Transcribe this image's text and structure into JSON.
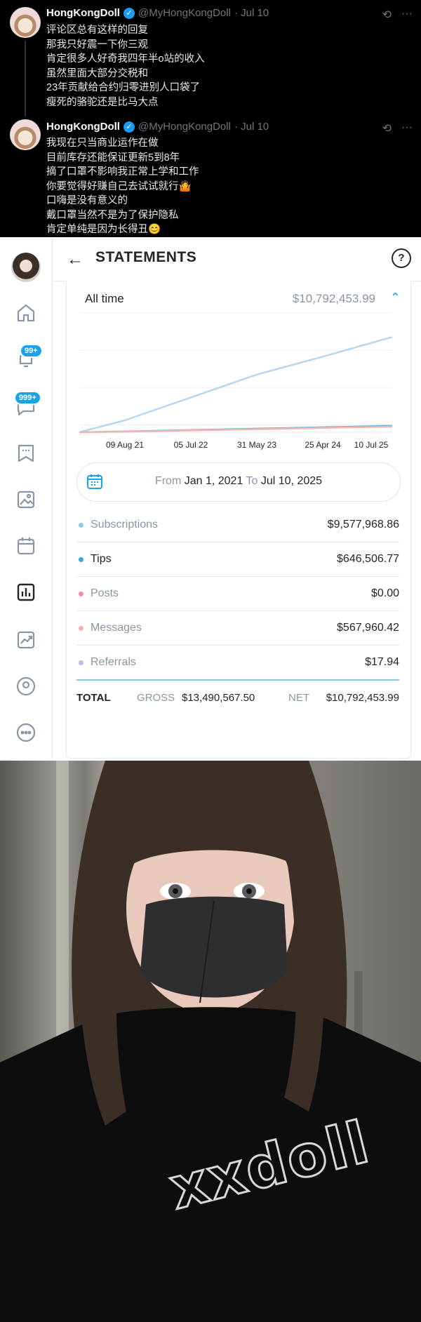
{
  "tweets": [
    {
      "name": "HongKongDoll",
      "handle": "@MyHongKongDoll",
      "date": "· Jul 10",
      "lines": [
        "评论区总有这样的回复",
        "那我只好震一下你三观",
        "肯定很多人好奇我四年半o站的收入",
        "虽然里面大部分交税和",
        "23年贡献给合约归零进别人口袋了",
        "瘦死的骆驼还是比马大点"
      ]
    },
    {
      "name": "HongKongDoll",
      "handle": "@MyHongKongDoll",
      "date": "· Jul 10",
      "lines": [
        "我现在只当商业运作在做",
        "目前库存还能保证更新5到8年",
        "摘了口罩不影响我正常上学和工作",
        "你要觉得好赚自己去试试就行🤷",
        "口嗨是没有意义的",
        "戴口罩当然不是为了保护隐私",
        "肯定单纯是因为长得丑😊"
      ]
    }
  ],
  "sidebar": {
    "notifications_badge": "99+",
    "messages_badge": "999+",
    "icons": [
      "home-icon",
      "bell-icon",
      "chat-icon",
      "bookmark-icon",
      "image-icon",
      "calendar-icon",
      "statistics-icon",
      "trend-icon",
      "profile-icon",
      "more-icon"
    ]
  },
  "header": {
    "title": "STATEMENTS"
  },
  "summary": {
    "period_label": "All time",
    "period_value": "$10,792,453.99"
  },
  "chart_data": {
    "type": "line",
    "x": [
      "09 Aug 21",
      "05 Jul 22",
      "31 May 23",
      "25 Apr 24",
      "10 Jul 25"
    ],
    "series": [
      {
        "values": [
          1200000,
          3500000,
          5800000,
          7600000,
          9577968
        ]
      },
      {
        "values": [
          80000,
          220000,
          360000,
          500000,
          646506
        ]
      },
      {
        "values": [
          60000,
          180000,
          310000,
          440000,
          567960
        ]
      }
    ],
    "colors": [
      "#b6d7f2",
      "#5fb3d9",
      "#f2b5b0"
    ],
    "grid": true
  },
  "date_range": {
    "from_label": "From",
    "from": "Jan 1, 2021",
    "to_label": "To",
    "to": "Jul 10, 2025"
  },
  "breakdown": [
    {
      "label": "Subscriptions",
      "amount": "$9,577,968.86",
      "color": "#8dc7ec"
    },
    {
      "label": "Tips",
      "amount": "$646,506.77",
      "color": "#3aa6d8"
    },
    {
      "label": "Posts",
      "amount": "$0.00",
      "color": "#f08ca6"
    },
    {
      "label": "Messages",
      "amount": "$567,960.42",
      "color": "#f5b1a8"
    },
    {
      "label": "Referrals",
      "amount": "$17.94",
      "color": "#c9b6e4"
    }
  ],
  "totals": {
    "label": "TOTAL",
    "gross_label": "GROSS",
    "gross": "$13,490,567.50",
    "net_label": "NET",
    "net": "$10,792,453.99"
  },
  "photo": {
    "shirt_text": "xxdoll"
  }
}
